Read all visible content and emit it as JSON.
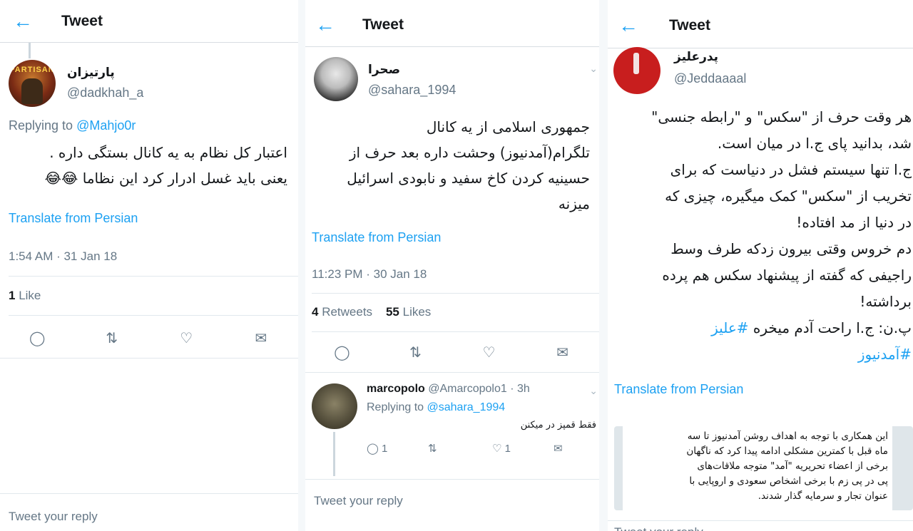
{
  "panel1": {
    "header": {
      "back": "←",
      "title": "Tweet"
    },
    "author": {
      "name": "پارتیزان",
      "handle": "@dadkhah_a",
      "avatar_text": "PARTISAN"
    },
    "replying_prefix": "Replying to ",
    "replying_handle": "@Mahjo0r",
    "body_lines": [
      "اعتبار کل نظام به یه کانال بستگی داره .",
      "یعنی باید غسل ادرار کرد این نظاما 😂😂"
    ],
    "translate": "Translate from Persian",
    "timestamp": "1:54 AM · 31 Jan 18",
    "likes_count": "1",
    "likes_label": " Like",
    "reply_placeholder": "Tweet your reply"
  },
  "panel2": {
    "header": {
      "back": "←",
      "title": "Tweet"
    },
    "author": {
      "name": "صحرا",
      "handle": "@sahara_1994"
    },
    "body_lines": [
      "جمهوری اسلامی از یه کانال",
      "تلگرام(آمدنیوز) وحشت داره بعد حرف از",
      "حسینیه کردن کاخ سفید و نابودی اسرائیل",
      "میزنه"
    ],
    "translate": "Translate from Persian",
    "timestamp": "11:23 PM · 30 Jan 18",
    "retweets_count": "4",
    "retweets_label": " Retweets",
    "likes_count": "55",
    "likes_label": " Likes",
    "reply": {
      "name": "marcopolo",
      "handle": "@Amarcopolo1 · 3h",
      "replying_prefix": "Replying to ",
      "replying_handle": "@sahara_1994",
      "text": "فقط قمپز در میکنن",
      "reply_count": "1",
      "like_count": "1"
    },
    "reply_placeholder": "Tweet your reply"
  },
  "panel3": {
    "header": {
      "back": "←",
      "title": "Tweet"
    },
    "author": {
      "name": "پدرعلیز",
      "handle": "@Jeddaaaal"
    },
    "body_lines": [
      "هر وقت حرف از \"سکس\" و \"رابطه جنسی\"",
      "شد، بدانید پای ج.ا در میان است.",
      "ج.ا تنها سیستم فشل در دنیاست که برای",
      "تخریب از \"سکس\" کمک میگیره، چیزی که",
      "در دنیا از مد افتاده!",
      "دم خروس وقتی بیرون زدکه طرف وسط",
      "راجیفی که گفته از پیشنهاد سکس هم پرده",
      "برداشته!"
    ],
    "ps_line": "پ.ن: ج.ا راحت آدم میخره ",
    "hashtag1": "#علیز",
    "hashtag2": "#آمدنیوز",
    "translate": "Translate from Persian",
    "image_lines": [
      "این همکاری با توجه به اهداف روشن آمدنیوز تا سه",
      "ماه قبل با کمترین مشکلی ادامه پیدا کرد که ناگهان",
      "برخی از اعضاء تحریریه \"آمد\" متوجه ملاقات‌های",
      "پی در پی زم با برخی اشخاص سعودی و اروپایی با",
      "عنوان تجار و سرمایه گذار شدند."
    ],
    "reply_placeholder": "Tweet your reply"
  }
}
